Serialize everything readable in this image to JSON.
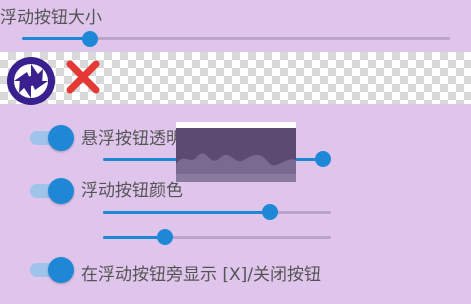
{
  "size_slider": {
    "label": "浮动按钮大小",
    "value_fraction": 0.15
  },
  "preview": {
    "icons": [
      {
        "name": "shutter-icon",
        "color": "#3a1f8e"
      },
      {
        "name": "close-icon",
        "color": "#e53935"
      }
    ]
  },
  "transparency": {
    "label": "悬浮按钮透明度",
    "enabled": true,
    "value_fraction": 0.97
  },
  "color": {
    "label": "浮动按钮颜色",
    "enabled": true,
    "slider1_fraction": 0.73,
    "slider2_fraction": 0.27
  },
  "show_close": {
    "label": "在浮动按钮旁显示 [X]/关闭按钮",
    "enabled": true
  },
  "colors": {
    "accent": "#1e88d6",
    "background": "#dfc4ec",
    "track": "#bba3c9"
  }
}
